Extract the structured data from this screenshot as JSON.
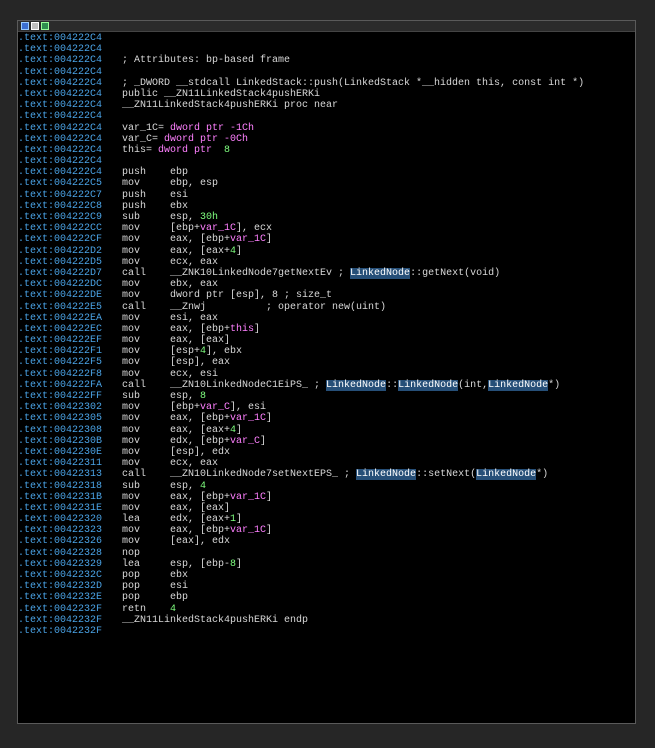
{
  "colors": {
    "background": "#262626",
    "listing": "#000000",
    "address": "#4aa3e6",
    "text": "#d8d8d8",
    "variable": "#ff80ff",
    "number": "#7fff7f",
    "highlight": "#264f78"
  },
  "titlebar": {
    "icons": [
      "graph-view-icon",
      "edit-icon",
      "hex-view-icon"
    ]
  },
  "lines": [
    {
      "addr": ".text:004222C4",
      "full": ""
    },
    {
      "addr": ".text:004222C4",
      "full": ""
    },
    {
      "addr": ".text:004222C4",
      "full": "; Attributes: bp-based frame"
    },
    {
      "addr": ".text:004222C4",
      "full": ""
    },
    {
      "addr": ".text:004222C4",
      "full": "; _DWORD __stdcall LinkedStack::push(LinkedStack *__hidden this, const int *)"
    },
    {
      "addr": ".text:004222C4",
      "full": "public __ZN11LinkedStack4pushERKi"
    },
    {
      "addr": ".text:004222C4",
      "full": "__ZN11LinkedStack4pushERKi proc near"
    },
    {
      "addr": ".text:004222C4",
      "full": ""
    },
    {
      "addr": ".text:004222C4",
      "full": "var_1C= dword ptr -1Ch",
      "kind": "var"
    },
    {
      "addr": ".text:004222C4",
      "full": "var_C= dword ptr -0Ch",
      "kind": "var"
    },
    {
      "addr": ".text:004222C4",
      "full": "this= dword ptr  8",
      "kind": "var"
    },
    {
      "addr": ".text:004222C4",
      "full": ""
    },
    {
      "addr": ".text:004222C4",
      "mn": "push",
      "op": "ebp"
    },
    {
      "addr": ".text:004222C5",
      "mn": "mov",
      "op": "ebp, esp"
    },
    {
      "addr": ".text:004222C7",
      "mn": "push",
      "op": "esi"
    },
    {
      "addr": ".text:004222C8",
      "mn": "push",
      "op": "ebx"
    },
    {
      "addr": ".text:004222C9",
      "mn": "sub",
      "op": "esp, 30h"
    },
    {
      "addr": ".text:004222CC",
      "mn": "mov",
      "op": "[ebp+var_1C], ecx"
    },
    {
      "addr": ".text:004222CF",
      "mn": "mov",
      "op": "eax, [ebp+var_1C]"
    },
    {
      "addr": ".text:004222D2",
      "mn": "mov",
      "op": "eax, [eax+4]"
    },
    {
      "addr": ".text:004222D5",
      "mn": "mov",
      "op": "ecx, eax"
    },
    {
      "addr": ".text:004222D7",
      "mn": "call",
      "op": "__ZNK10LinkedNode7getNextEv ; LinkedNode::getNext(void)"
    },
    {
      "addr": ".text:004222DC",
      "mn": "mov",
      "op": "ebx, eax"
    },
    {
      "addr": ".text:004222DE",
      "mn": "mov",
      "op": "dword ptr [esp], 8 ; size_t"
    },
    {
      "addr": ".text:004222E5",
      "mn": "call",
      "op": "__Znwj          ; operator new(uint)"
    },
    {
      "addr": ".text:004222EA",
      "mn": "mov",
      "op": "esi, eax"
    },
    {
      "addr": ".text:004222EC",
      "mn": "mov",
      "op": "eax, [ebp+this]"
    },
    {
      "addr": ".text:004222EF",
      "mn": "mov",
      "op": "eax, [eax]"
    },
    {
      "addr": ".text:004222F1",
      "mn": "mov",
      "op": "[esp+4], ebx"
    },
    {
      "addr": ".text:004222F5",
      "mn": "mov",
      "op": "[esp], eax"
    },
    {
      "addr": ".text:004222F8",
      "mn": "mov",
      "op": "ecx, esi"
    },
    {
      "addr": ".text:004222FA",
      "mn": "call",
      "op": "__ZN10LinkedNodeC1EiPS_ ; LinkedNode::LinkedNode(int,LinkedNode*)"
    },
    {
      "addr": ".text:004222FF",
      "mn": "sub",
      "op": "esp, 8"
    },
    {
      "addr": ".text:00422302",
      "mn": "mov",
      "op": "[ebp+var_C], esi"
    },
    {
      "addr": ".text:00422305",
      "mn": "mov",
      "op": "eax, [ebp+var_1C]"
    },
    {
      "addr": ".text:00422308",
      "mn": "mov",
      "op": "eax, [eax+4]"
    },
    {
      "addr": ".text:0042230B",
      "mn": "mov",
      "op": "edx, [ebp+var_C]"
    },
    {
      "addr": ".text:0042230E",
      "mn": "mov",
      "op": "[esp], edx"
    },
    {
      "addr": ".text:00422311",
      "mn": "mov",
      "op": "ecx, eax"
    },
    {
      "addr": ".text:00422313",
      "mn": "call",
      "op": "__ZN10LinkedNode7setNextEPS_ ; LinkedNode::setNext(LinkedNode*)"
    },
    {
      "addr": ".text:00422318",
      "mn": "sub",
      "op": "esp, 4"
    },
    {
      "addr": ".text:0042231B",
      "mn": "mov",
      "op": "eax, [ebp+var_1C]"
    },
    {
      "addr": ".text:0042231E",
      "mn": "mov",
      "op": "eax, [eax]"
    },
    {
      "addr": ".text:00422320",
      "mn": "lea",
      "op": "edx, [eax+1]"
    },
    {
      "addr": ".text:00422323",
      "mn": "mov",
      "op": "eax, [ebp+var_1C]"
    },
    {
      "addr": ".text:00422326",
      "mn": "mov",
      "op": "[eax], edx"
    },
    {
      "addr": ".text:00422328",
      "mn": "nop",
      "op": ""
    },
    {
      "addr": ".text:00422329",
      "mn": "lea",
      "op": "esp, [ebp-8]"
    },
    {
      "addr": ".text:0042232C",
      "mn": "pop",
      "op": "ebx"
    },
    {
      "addr": ".text:0042232D",
      "mn": "pop",
      "op": "esi"
    },
    {
      "addr": ".text:0042232E",
      "mn": "pop",
      "op": "ebp"
    },
    {
      "addr": ".text:0042232F",
      "mn": "retn",
      "op": "4"
    },
    {
      "addr": ".text:0042232F",
      "full": "__ZN11LinkedStack4pushERKi endp"
    },
    {
      "addr": ".text:0042232F",
      "full": ""
    }
  ]
}
